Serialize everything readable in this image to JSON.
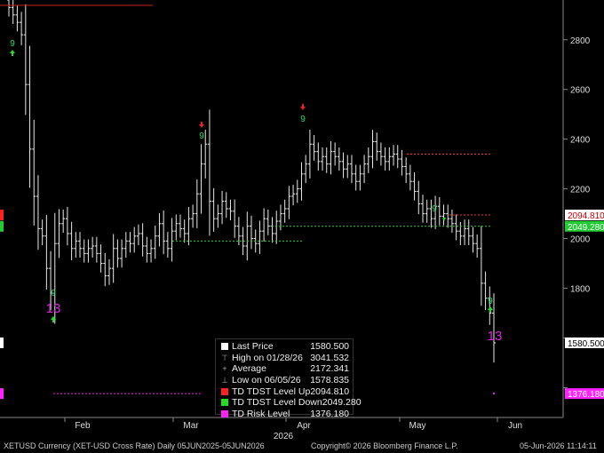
{
  "chart_data": {
    "type": "candlestick",
    "x_axis": {
      "month_ticks": [
        "Feb",
        "Mar",
        "Apr",
        "May",
        "Jun"
      ],
      "year_label": "2026"
    },
    "y_axis": {
      "side": "right",
      "ticks": [
        1400,
        1600,
        1800,
        2000,
        2200,
        2400,
        2600,
        2800
      ],
      "ylim": [
        1280,
        2960
      ],
      "tick_labels_visible": [
        "1800",
        "2000",
        "2200",
        "2400",
        "2600",
        "2800"
      ]
    },
    "series": [
      {
        "name": "XETUSD",
        "closes": [
          2930,
          2900,
          2870,
          2820,
          2620,
          2360,
          2170,
          2040,
          2010,
          1880,
          1780,
          1980,
          2060,
          2080,
          2020,
          1960,
          1990,
          1960,
          1940,
          1960,
          1970,
          1940,
          1900,
          1850,
          1880,
          1960,
          1920,
          1960,
          1990,
          1980,
          2010,
          2020,
          1970,
          1940,
          1960,
          2010,
          2060,
          1990,
          1960,
          2030,
          2060,
          2040,
          2020,
          2080,
          2100,
          2180,
          2300,
          2380,
          2150,
          2080,
          2100,
          2150,
          2120,
          2110,
          2050,
          2010,
          1970,
          2050,
          2000,
          1980,
          2030,
          2080,
          2050,
          2020,
          2070,
          2100,
          2120,
          2170,
          2180,
          2200,
          2260,
          2300,
          2380,
          2350,
          2310,
          2330,
          2300,
          2350,
          2330,
          2310,
          2280,
          2300,
          2260,
          2230,
          2260,
          2300,
          2330,
          2390,
          2350,
          2330,
          2310,
          2330,
          2340,
          2320,
          2290,
          2260,
          2230,
          2190,
          2140,
          2100,
          2120,
          2080,
          2130,
          2090,
          2100,
          2080,
          2060,
          2030,
          2010,
          2040,
          2010,
          1980,
          1960,
          1820,
          1760,
          1700,
          1580.5
        ],
        "high": 3041.532,
        "low": 1578.835
      }
    ],
    "markers": [
      {
        "label": "9",
        "kind": "TD countdown setup",
        "color": "#19e070",
        "index": 2,
        "arrow": "up"
      },
      {
        "label": "9",
        "kind": "TD countdown setup",
        "color": "#19e070",
        "index": 13,
        "arrow": "none"
      },
      {
        "label": "13",
        "kind": "TD countdown",
        "color": "#dd22dd",
        "index": 13,
        "arrow": "up"
      },
      {
        "label": "9",
        "kind": "TD countdown setup",
        "color": "#19e070",
        "index": 54,
        "arrow": "down"
      },
      {
        "label": "9",
        "kind": "TD countdown setup",
        "color": "#19e070",
        "index": 79,
        "arrow": "down"
      },
      {
        "label": "9",
        "kind": "TD countdown setup",
        "color": "#19e070",
        "index": 115,
        "arrow": "down"
      },
      {
        "label": "9",
        "kind": "TD countdown setup",
        "color": "#19e070",
        "index": 130,
        "arrow": "up"
      },
      {
        "label": "13",
        "kind": "TD countdown",
        "color": "#dd22dd",
        "index": 130,
        "arrow": "none"
      }
    ],
    "levels": [
      {
        "name": "TD TDST Level Up",
        "value": 2094.81,
        "color": "#ff3333"
      },
      {
        "name": "TD TDST Level Down",
        "value": 2049.28,
        "color": "#22dd44"
      },
      {
        "name": "TD Risk Level",
        "value": 1376.18,
        "color": "#ff22ff"
      }
    ],
    "price_tags": [
      {
        "text": "2094.810",
        "bg": "#ffffff",
        "fg": "#cc0000",
        "left_bg": "#ff2222",
        "value": 2094.81
      },
      {
        "text": "2049.280",
        "bg": "#22cc33",
        "fg": "#ffffff",
        "left_bg": "#22cc33",
        "value": 2049.28
      },
      {
        "text": "1580.500",
        "bg": "#ffffff",
        "fg": "#000000",
        "left_bg": "#ffffff",
        "value": 1580.5
      },
      {
        "text": "1376.180",
        "bg": "#ff22ff",
        "fg": "#ffffff",
        "left_bg": "#ff22ff",
        "value": 1376.18
      }
    ]
  },
  "legend": [
    {
      "glyph": "",
      "color": "#ffffff",
      "label": "Last Price",
      "value": "1580.500"
    },
    {
      "glyph": "⊤",
      "color": "#aaaaaa",
      "label": "High on 01/28/26",
      "value": "3041.532"
    },
    {
      "glyph": "+",
      "color": "#aaaaaa",
      "label": "Average",
      "value": "2172.341"
    },
    {
      "glyph": "⊥",
      "color": "#aaaaaa",
      "label": "Low on 06/05/26",
      "value": "1578.835"
    },
    {
      "glyph": "",
      "color": "#ff2222",
      "label": "TD TDST Level Up",
      "value": "2094.810"
    },
    {
      "glyph": "",
      "color": "#22dd22",
      "label": "TD TDST Level Down",
      "value": "2049.280"
    },
    {
      "glyph": "",
      "color": "#ff22ff",
      "label": "TD Risk Level",
      "value": "1376.180"
    }
  ],
  "footer": {
    "left": "XETUSD Currency (XET-USD Cross Rate) Daily 05JUN2025-05JUN2026",
    "center": "Copyright© 2026 Bloomberg Finance L.P.",
    "right": "05-Jun-2026 11:14:11"
  }
}
